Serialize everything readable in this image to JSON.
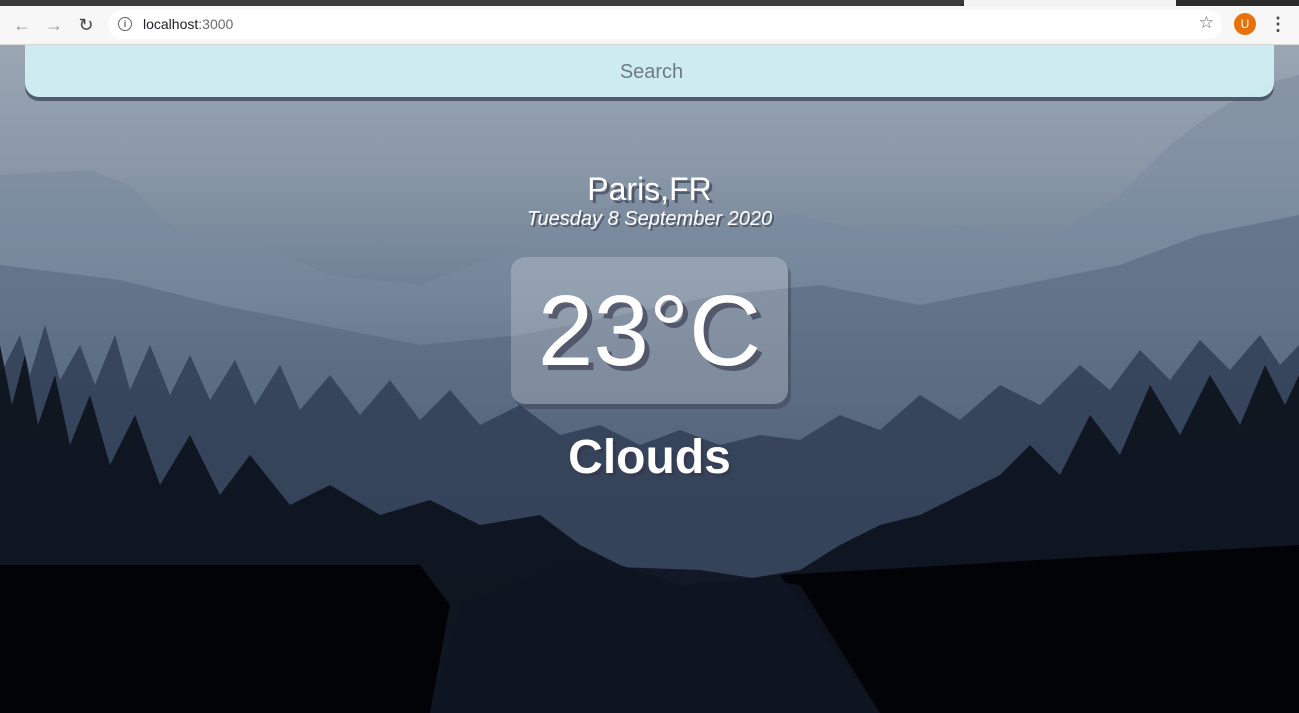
{
  "browser": {
    "url_host": "localhost",
    "url_port": ":3000",
    "avatar_letter": "U"
  },
  "search": {
    "placeholder": "Search"
  },
  "weather": {
    "location": "Paris,FR",
    "date": "Tuesday 8 September 2020",
    "temperature": "23°C",
    "condition": "Clouds"
  },
  "colors": {
    "search_bg": "#ceedf3",
    "text": "#ffffff",
    "avatar": "#e8710a"
  },
  "icons": {
    "back": "arrow-left",
    "forward": "arrow-right",
    "reload": "reload",
    "site_info": "info-circle",
    "bookmark": "star-outline",
    "menu": "vertical-dots"
  }
}
